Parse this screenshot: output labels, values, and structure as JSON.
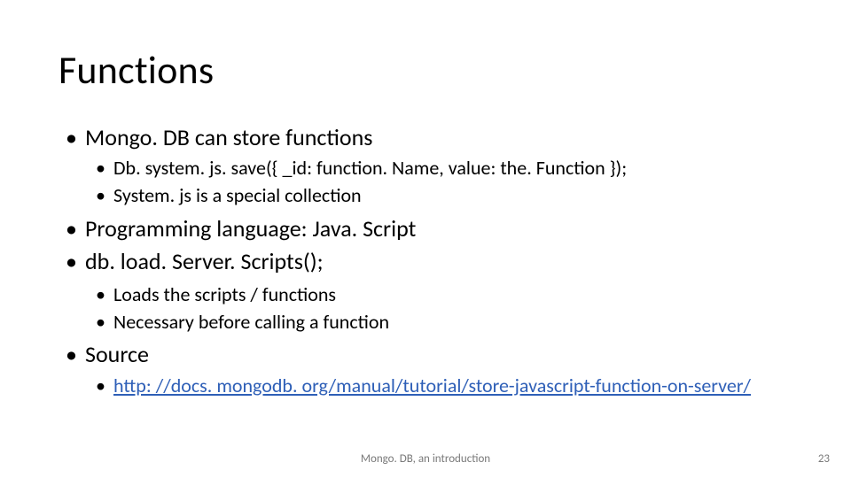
{
  "title": "Functions",
  "bullets": {
    "b1": "Mongo. DB can store functions",
    "b1a": "Db. system. js. save({ _id: function. Name, value: the. Function });",
    "b1b": "System. js is a special collection",
    "b2": "Programming language: Java. Script",
    "b3": "db. load. Server. Scripts();",
    "b3a": "Loads the scripts / functions",
    "b3b": "Necessary before calling a function",
    "b4": "Source",
    "b4a_link": "http: //docs. mongodb. org/manual/tutorial/store-javascript-function-on-server/"
  },
  "footer": {
    "center": "Mongo. DB, an introduction",
    "pageNumber": "23"
  }
}
